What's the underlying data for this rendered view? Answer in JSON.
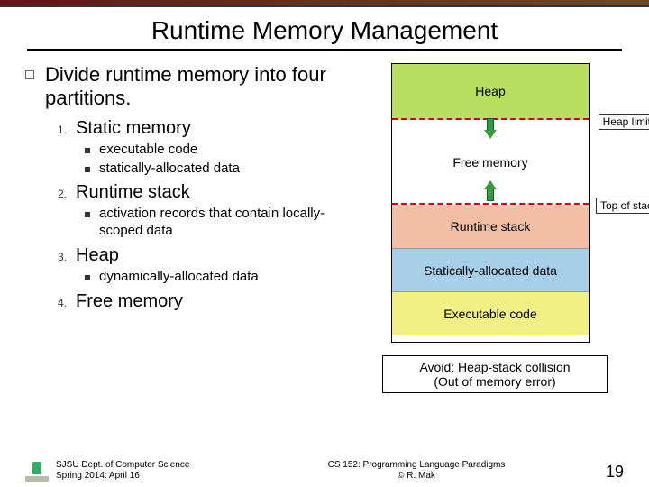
{
  "title": "Runtime Memory Management",
  "intro": "Divide runtime memory into four partitions.",
  "items": [
    {
      "num": "1.",
      "label": "Static memory",
      "subs": [
        "executable code",
        "statically-allocated data"
      ]
    },
    {
      "num": "2.",
      "label": "Runtime stack",
      "subs": [
        "activation records that contain locally-scoped data"
      ]
    },
    {
      "num": "3.",
      "label": "Heap",
      "subs": [
        "dynamically-allocated data"
      ]
    },
    {
      "num": "4.",
      "label": "Free memory",
      "subs": []
    }
  ],
  "diagram": {
    "heap": "Heap",
    "free": "Free memory",
    "stack": "Runtime stack",
    "static": "Statically-allocated data",
    "exec": "Executable code",
    "heap_limit": "Heap limit",
    "top_of_stack": "Top of stack"
  },
  "avoid": {
    "line1": "Avoid: Heap-stack collision",
    "line2": "(Out of memory error)"
  },
  "footer": {
    "left1": "SJSU Dept. of Computer Science",
    "left2": "Spring 2014: April 16",
    "mid1": "CS 152: Programming Language Paradigms",
    "mid2": "© R. Mak",
    "page": "19"
  }
}
